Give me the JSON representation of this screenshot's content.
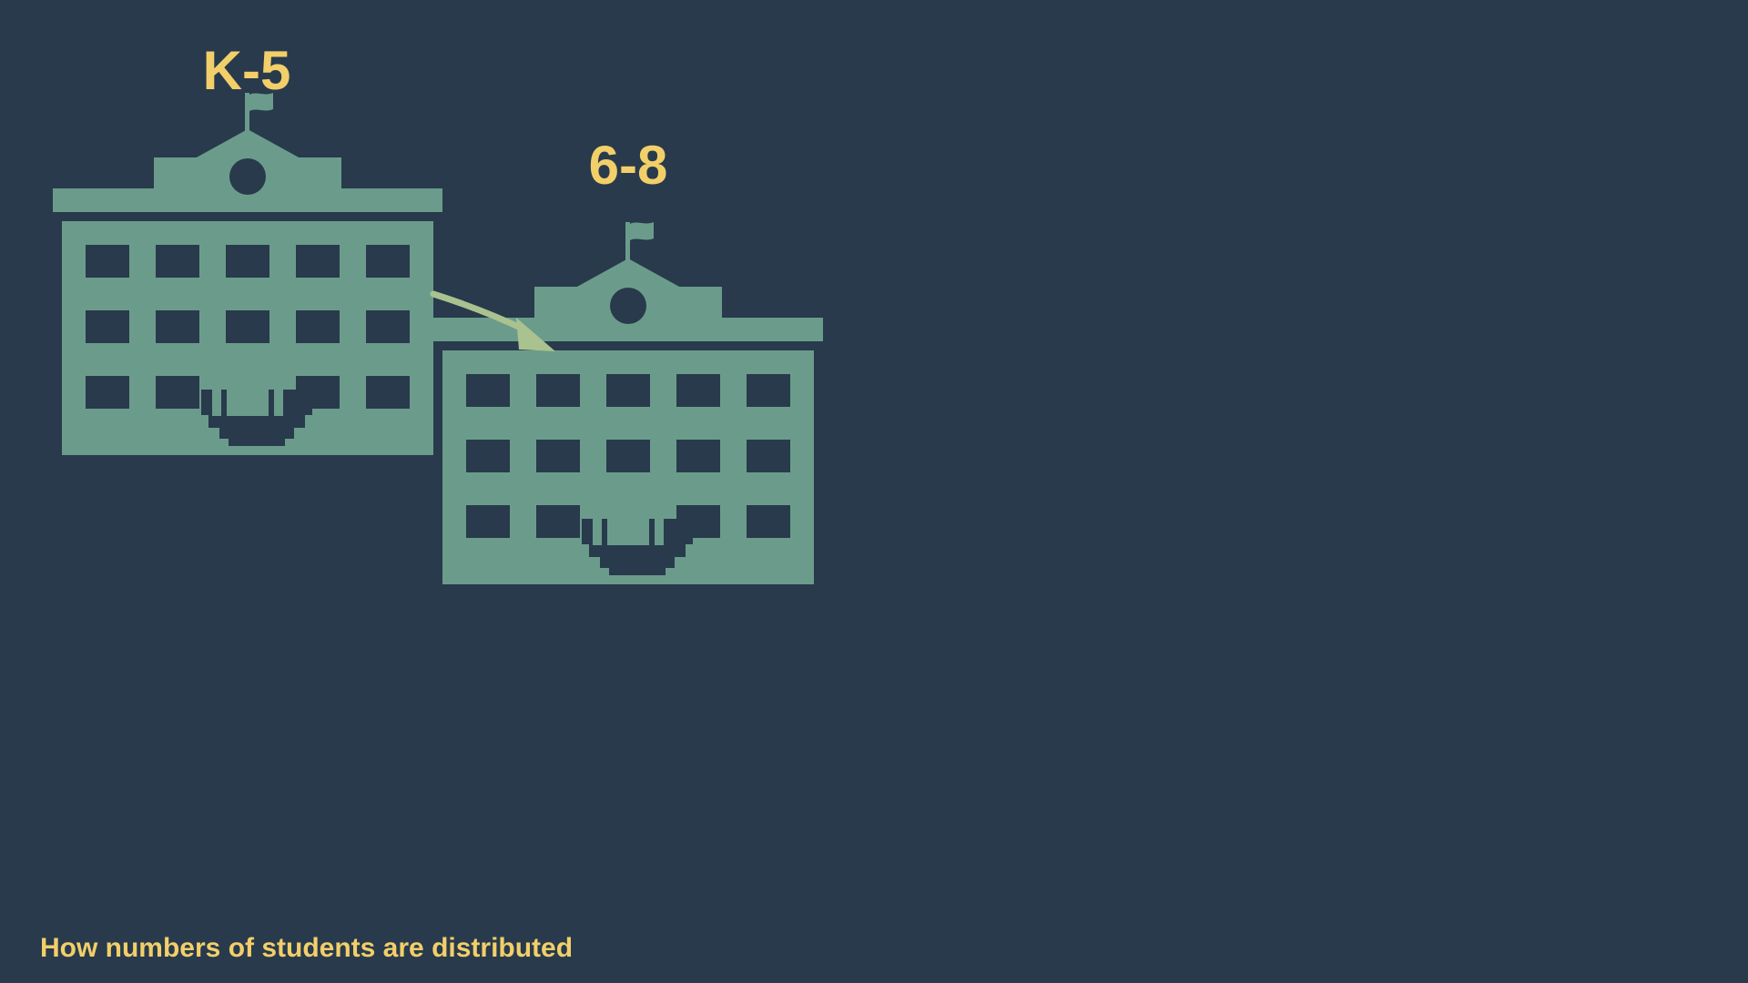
{
  "schools": [
    {
      "label": "K-5",
      "icon": "school-building-icon"
    },
    {
      "label": "6-8",
      "icon": "school-building-icon"
    }
  ],
  "transition": {
    "from": "K-5",
    "to": "6-8",
    "icon": "curved-arrow-icon"
  },
  "caption": "How numbers of students are distributed",
  "colors": {
    "background": "#283a4c",
    "building": "#6b9c8b",
    "accent_text": "#f2cf69",
    "arrow": "#a9c28f"
  }
}
